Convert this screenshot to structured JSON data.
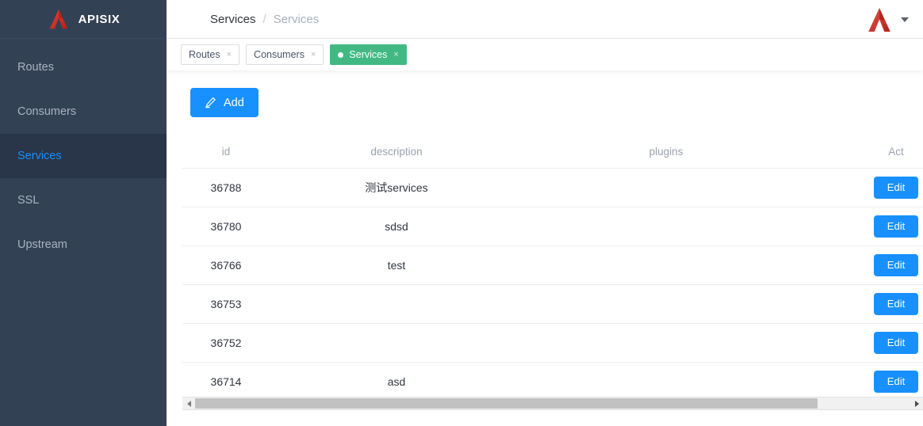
{
  "sidebar": {
    "logo_text": "APISIX",
    "logo_icon": "apisix-logo-icon",
    "items": [
      {
        "label": "Routes",
        "active": false
      },
      {
        "label": "Consumers",
        "active": false
      },
      {
        "label": "Services",
        "active": true
      },
      {
        "label": "SSL",
        "active": false
      },
      {
        "label": "Upstream",
        "active": false
      }
    ]
  },
  "header": {
    "breadcrumb": {
      "current": "Services",
      "separator": "/",
      "link": "Services"
    },
    "user_logo_icon": "apisix-avatar-icon",
    "caret_icon": "chevron-down-icon"
  },
  "tabbar": {
    "tabs": [
      {
        "label": "Routes",
        "active": false,
        "close": "×"
      },
      {
        "label": "Consumers",
        "active": false,
        "close": "×"
      },
      {
        "label": "Services",
        "active": true,
        "close": "×"
      }
    ]
  },
  "toolbar": {
    "add_label": "Add",
    "add_icon": "pencil-icon"
  },
  "table": {
    "columns": [
      "id",
      "description",
      "plugins",
      "Act"
    ],
    "rows": [
      {
        "id": "36788",
        "description": "测试services",
        "plugins": "",
        "action": "Edit"
      },
      {
        "id": "36780",
        "description": "sdsd",
        "plugins": "",
        "action": "Edit"
      },
      {
        "id": "36766",
        "description": "test",
        "plugins": "",
        "action": "Edit"
      },
      {
        "id": "36753",
        "description": "",
        "plugins": "",
        "action": "Edit"
      },
      {
        "id": "36752",
        "description": "",
        "plugins": "",
        "action": "Edit"
      },
      {
        "id": "36714",
        "description": "asd",
        "plugins": "",
        "action": "Edit"
      }
    ]
  },
  "scrollbar": {
    "left_arrow": "scroll-left-arrow-icon",
    "right_arrow": "scroll-right-arrow-icon",
    "thumb_percent": 87
  },
  "colors": {
    "sidebar_bg": "#334155",
    "sidebar_active_bg": "#293548",
    "accent_blue": "#1890ff",
    "tab_active_green": "#42b983",
    "logo_red": "#c7241a"
  }
}
